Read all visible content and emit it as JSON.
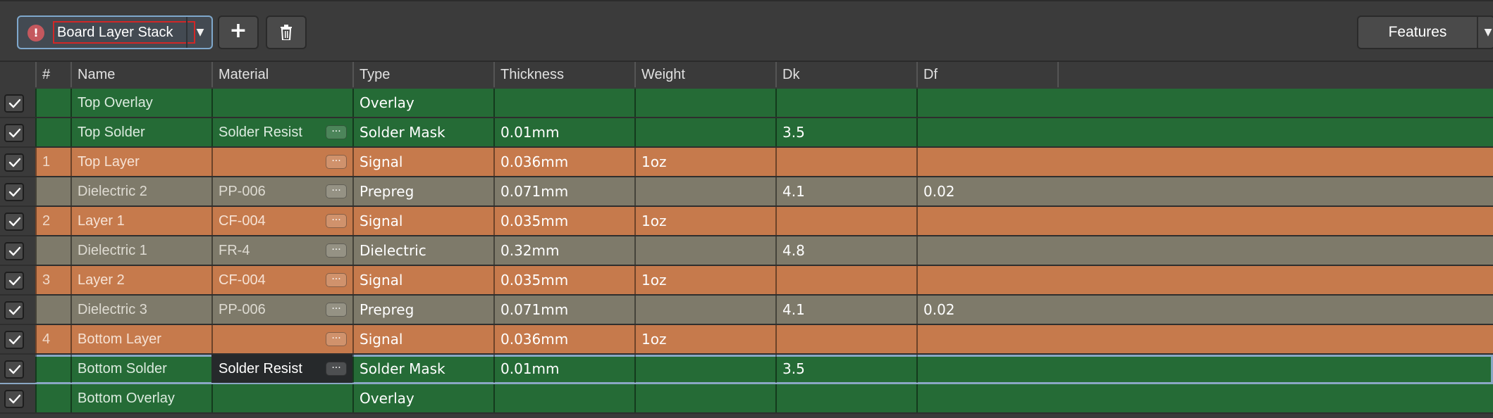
{
  "toolbar": {
    "stack_name": "Board Layer Stack",
    "add_label": "+",
    "features_label": "Features"
  },
  "columns": [
    "",
    "#",
    "Name",
    "Material",
    "Type",
    "Thickness",
    "Weight",
    "Dk",
    "Df"
  ],
  "rows": [
    {
      "num": "",
      "name": "Top Overlay",
      "material": "",
      "type": "Overlay",
      "thickness": "",
      "weight": "",
      "dk": "",
      "df": "",
      "color": "green",
      "has_material_button": false,
      "checked": true
    },
    {
      "num": "",
      "name": "Top Solder",
      "material": "Solder Resist",
      "type": "Solder Mask",
      "thickness": "0.01mm",
      "weight": "",
      "dk": "3.5",
      "df": "",
      "color": "green",
      "has_material_button": true,
      "checked": true
    },
    {
      "num": "1",
      "name": "Top Layer",
      "material": "",
      "type": "Signal",
      "thickness": "0.036mm",
      "weight": "1oz",
      "dk": "",
      "df": "",
      "color": "orange",
      "has_material_button": true,
      "checked": true
    },
    {
      "num": "",
      "name": "Dielectric 2",
      "material": "PP-006",
      "type": "Prepreg",
      "thickness": "0.071mm",
      "weight": "",
      "dk": "4.1",
      "df": "0.02",
      "color": "gray",
      "has_material_button": true,
      "checked": true
    },
    {
      "num": "2",
      "name": "Layer 1",
      "material": "CF-004",
      "type": "Signal",
      "thickness": "0.035mm",
      "weight": "1oz",
      "dk": "",
      "df": "",
      "color": "orange",
      "has_material_button": true,
      "checked": true
    },
    {
      "num": "",
      "name": "Dielectric 1",
      "material": "FR-4",
      "type": "Dielectric",
      "thickness": "0.32mm",
      "weight": "",
      "dk": "4.8",
      "df": "",
      "color": "gray",
      "has_material_button": true,
      "checked": true
    },
    {
      "num": "3",
      "name": "Layer 2",
      "material": "CF-004",
      "type": "Signal",
      "thickness": "0.035mm",
      "weight": "1oz",
      "dk": "",
      "df": "",
      "color": "orange",
      "has_material_button": true,
      "checked": true
    },
    {
      "num": "",
      "name": "Dielectric 3",
      "material": "PP-006",
      "type": "Prepreg",
      "thickness": "0.071mm",
      "weight": "",
      "dk": "4.1",
      "df": "0.02",
      "color": "gray",
      "has_material_button": true,
      "checked": true
    },
    {
      "num": "4",
      "name": "Bottom Layer",
      "material": "",
      "type": "Signal",
      "thickness": "0.036mm",
      "weight": "1oz",
      "dk": "",
      "df": "",
      "color": "orange",
      "has_material_button": true,
      "checked": true
    },
    {
      "num": "",
      "name": "Bottom Solder",
      "material": "Solder Resist",
      "type": "Solder Mask",
      "thickness": "0.01mm",
      "weight": "",
      "dk": "3.5",
      "df": "",
      "color": "green",
      "has_material_button": true,
      "checked": true,
      "selected": true
    },
    {
      "num": "",
      "name": "Bottom Overlay",
      "material": "",
      "type": "Overlay",
      "thickness": "",
      "weight": "",
      "dk": "",
      "df": "",
      "color": "green",
      "has_material_button": false,
      "checked": true
    }
  ],
  "material_button_label": "···",
  "colors": {
    "signal_layer": "#c67a4c",
    "dielectric_layer": "#7e7a6a",
    "mask_overlay_layer": "#256b36",
    "selection_outline": "#8aa7c4",
    "warning": "#c4585e"
  }
}
